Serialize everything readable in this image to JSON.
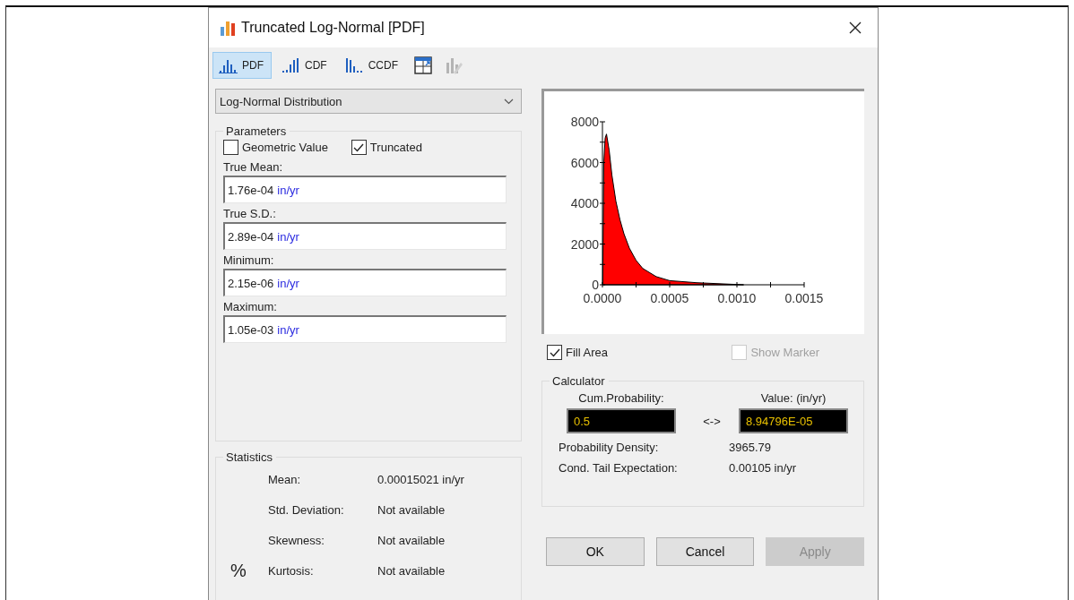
{
  "window": {
    "title": "Truncated Log-Normal [PDF]"
  },
  "views": [
    {
      "label": "PDF",
      "kind": "pdf",
      "selected": true
    },
    {
      "label": "CDF",
      "kind": "cdf",
      "selected": false
    },
    {
      "label": "CCDF",
      "kind": "ccdf",
      "selected": false
    }
  ],
  "tools": [
    {
      "kind": "window",
      "disabled": false
    },
    {
      "kind": "edit",
      "disabled": true
    }
  ],
  "distribution": {
    "value": "Log-Normal Distribution"
  },
  "parameters": {
    "title": "Parameters",
    "checkboxes": [
      {
        "label": "Geometric Value",
        "checked": false
      },
      {
        "label": "Truncated",
        "checked": true
      }
    ],
    "fields": [
      {
        "label": "True Mean:",
        "value": "1.76e-04",
        "unit": "in/yr"
      },
      {
        "label": "True S.D.:",
        "value": "2.89e-04",
        "unit": "in/yr"
      },
      {
        "label": "Minimum:",
        "value": "2.15e-06",
        "unit": "in/yr"
      },
      {
        "label": "Maximum:",
        "value": "1.05e-03",
        "unit": "in/yr"
      }
    ]
  },
  "statistics": {
    "title": "Statistics",
    "rows": [
      {
        "label": "Mean:",
        "value": "0.00015021 in/yr"
      },
      {
        "label": "Std. Deviation:",
        "value": "Not available"
      },
      {
        "label": "Skewness:",
        "value": "Not available"
      },
      {
        "label": "Kurtosis:",
        "value": "Not available",
        "prefix": "%"
      }
    ]
  },
  "chart": {
    "chart_data": {
      "type": "area",
      "x": [
        2.2e-06,
        1e-05,
        2e-05,
        3e-05,
        5e-05,
        7e-05,
        0.0001,
        0.00013,
        0.00016,
        0.0002,
        0.00025,
        0.0003,
        0.0004,
        0.0005,
        0.0007,
        0.00105
      ],
      "series": [
        {
          "color": "#ff0000",
          "values": [
            0,
            6000,
            7200,
            7400,
            6600,
            5400,
            4100,
            3200,
            2500,
            1800,
            1200,
            800,
            400,
            200,
            100,
            0
          ]
        }
      ],
      "xlim": [
        0,
        0.0015
      ],
      "ylim": [
        0,
        8000
      ],
      "xticks": [
        {
          "value": 0,
          "label": "0.0000"
        },
        {
          "value": 0.0005,
          "label": "0.0005"
        },
        {
          "value": 0.001,
          "label": "0.0010"
        },
        {
          "value": 0.0015,
          "label": "0.0015"
        }
      ],
      "yticks": [
        0,
        2000,
        4000,
        6000,
        8000
      ]
    }
  },
  "options": [
    {
      "label": "Fill Area",
      "checked": true,
      "disabled": false
    },
    {
      "label": "Show Marker",
      "checked": false,
      "disabled": true
    }
  ],
  "calculator": {
    "title": "Calculator",
    "probability_label": "Cum.Probability:",
    "probability": "0.5",
    "arrow": "<->",
    "value_label": "Value: (in/yr)",
    "value": "8.94796E-05",
    "results": [
      {
        "label": "Probability Density:",
        "value": "3965.79"
      },
      {
        "label": "Cond. Tail Expectation:",
        "value": "0.00105 in/yr"
      }
    ]
  },
  "buttons": [
    {
      "label": "OK",
      "disabled": false
    },
    {
      "label": "Cancel",
      "disabled": false
    },
    {
      "label": "Apply",
      "disabled": true
    }
  ]
}
